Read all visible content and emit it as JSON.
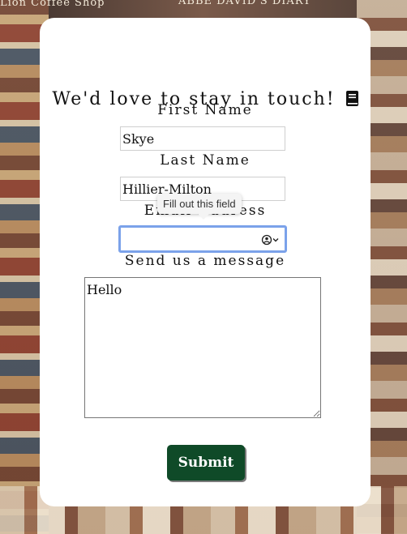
{
  "background": {
    "left_title": "Lion Coffee Shop",
    "top_title": "ABBE DAVID'S DIARY"
  },
  "form": {
    "heading": "We'd love to stay in touch!",
    "heading_icon": "book-icon",
    "first_name_label": "First Name",
    "first_name_value": "Skye",
    "last_name_label": "Last Name",
    "last_name_value": "Hillier-Milton",
    "email_label": "Email Address",
    "email_value": "",
    "email_tooltip": "Fill out this field",
    "message_label": "Send us a message",
    "message_value": "Hello",
    "submit_label": "Submit"
  },
  "colors": {
    "submit_bg": "#0f4a28",
    "focus_ring": "#7ba2ea",
    "card_bg": "#ffffff"
  }
}
